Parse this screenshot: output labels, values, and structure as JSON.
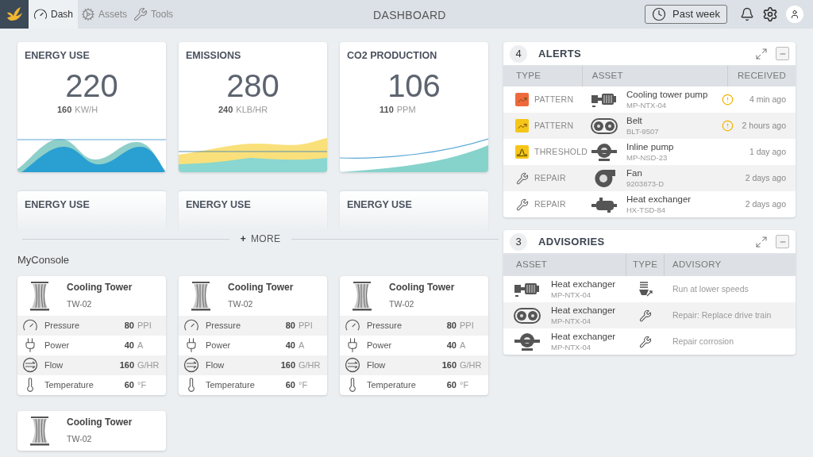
{
  "topbar": {
    "nav": [
      {
        "label": "Dash",
        "kind": "gauge",
        "selected": true
      },
      {
        "label": "Assets",
        "kind": "cog",
        "selected": false
      },
      {
        "label": "Tools",
        "kind": "wrench",
        "selected": false
      }
    ],
    "title": "DASHBOARD",
    "period": "Past week"
  },
  "kpis": [
    {
      "title": "ENERGY USE",
      "value": "220",
      "sub_value": "160",
      "unit": "KW/H",
      "kind": "waves"
    },
    {
      "title": "EMISSIONS",
      "value": "280",
      "sub_value": "240",
      "unit": "KLB/HR",
      "kind": "layers"
    },
    {
      "title": "CO2 PRODUCTION",
      "value": "106",
      "sub_value": "110",
      "unit": "PPM",
      "kind": "rising"
    }
  ],
  "more_cards": [
    {
      "title": "ENERGY USE"
    },
    {
      "title": "ENERGY USE"
    },
    {
      "title": "ENERGY USE"
    }
  ],
  "more": {
    "icon": "+",
    "label": "MORE"
  },
  "console": {
    "title": "MyConsole",
    "cards": [
      {
        "name": "Cooling Tower",
        "code": "TW-02",
        "metrics": [
          {
            "kind": "pressure",
            "label": "Pressure",
            "value": "80",
            "unit": "PPI"
          },
          {
            "kind": "power",
            "label": "Power",
            "value": "40",
            "unit": "A"
          },
          {
            "kind": "flow",
            "label": "Flow",
            "value": "160",
            "unit": "G/HR"
          },
          {
            "kind": "temperature",
            "label": "Temperature",
            "value": "60",
            "unit": "°F"
          }
        ]
      },
      {
        "name": "Cooling Tower",
        "code": "TW-02",
        "metrics": [
          {
            "kind": "pressure",
            "label": "Pressure",
            "value": "80",
            "unit": "PPI"
          },
          {
            "kind": "power",
            "label": "Power",
            "value": "40",
            "unit": "A"
          },
          {
            "kind": "flow",
            "label": "Flow",
            "value": "160",
            "unit": "G/HR"
          },
          {
            "kind": "temperature",
            "label": "Temperature",
            "value": "60",
            "unit": "°F"
          }
        ]
      },
      {
        "name": "Cooling Tower",
        "code": "TW-02",
        "metrics": [
          {
            "kind": "pressure",
            "label": "Pressure",
            "value": "80",
            "unit": "PPI"
          },
          {
            "kind": "power",
            "label": "Power",
            "value": "40",
            "unit": "A"
          },
          {
            "kind": "flow",
            "label": "Flow",
            "value": "160",
            "unit": "G/HR"
          },
          {
            "kind": "temperature",
            "label": "Temperature",
            "value": "60",
            "unit": "°F"
          }
        ]
      },
      {
        "name": "Cooling Tower",
        "code": "TW-02"
      }
    ]
  },
  "alerts": {
    "count": "4",
    "title": "ALERTS",
    "columns": [
      "TYPE",
      "ASSET",
      "RECEIVED"
    ],
    "rows": [
      {
        "type": {
          "kind": "pattern",
          "color": "#ee6a3c",
          "label": "PATTERN"
        },
        "asset": {
          "kind": "motor",
          "name": "Cooling tower pump",
          "code": "MP-NTX-04"
        },
        "warning": true,
        "received": "4 min ago"
      },
      {
        "type": {
          "kind": "pattern",
          "color": "#f5c518",
          "label": "PATTERN"
        },
        "asset": {
          "kind": "belt",
          "name": "Belt",
          "code": "BLT-9507"
        },
        "warning": true,
        "received": "2 hours ago"
      },
      {
        "type": {
          "kind": "threshold",
          "color": "#f5c518",
          "label": "THRESHOLD"
        },
        "asset": {
          "kind": "pump",
          "name": "Inline pump",
          "code": "MP-NSD-23"
        },
        "warning": false,
        "received": "1 day ago"
      },
      {
        "type": {
          "kind": "repair",
          "label": "REPAIR"
        },
        "asset": {
          "kind": "fan",
          "name": "Fan",
          "code": "9203873-D"
        },
        "warning": false,
        "received": "2 days ago"
      },
      {
        "type": {
          "kind": "repair",
          "label": "REPAIR"
        },
        "asset": {
          "kind": "exchanger",
          "name": "Heat exchanger",
          "code": "HX-TSD-84"
        },
        "warning": false,
        "received": "2 days ago"
      }
    ]
  },
  "advisories": {
    "count": "3",
    "title": "ADVISORIES",
    "columns": [
      "ASSET",
      "TYPE",
      "ADVISORY"
    ],
    "rows": [
      {
        "asset": {
          "kind": "motor",
          "name": "Heat exchanger",
          "code": "MP-NTX-04"
        },
        "type": {
          "kind": "speed"
        },
        "advisory": "Run at lower speeds"
      },
      {
        "asset": {
          "kind": "belt",
          "name": "Heat exchanger",
          "code": "MP-NTX-04"
        },
        "type": {
          "kind": "repair"
        },
        "advisory": "Repair: Replace drive train"
      },
      {
        "asset": {
          "kind": "pump",
          "name": "Heat exchanger",
          "code": "MP-NTX-04"
        },
        "type": {
          "kind": "repair"
        },
        "advisory": "Repair corrosion"
      }
    ]
  }
}
